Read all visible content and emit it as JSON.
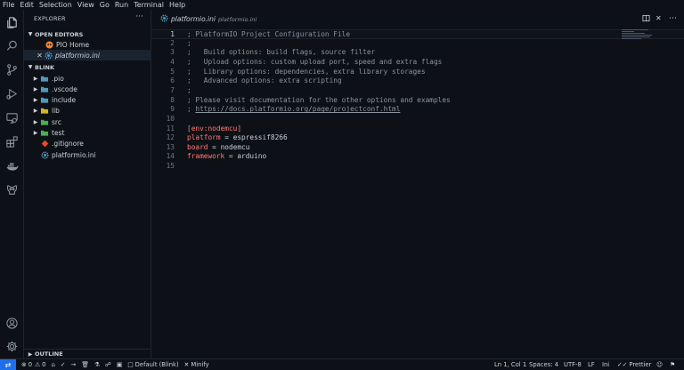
{
  "menu": [
    "File",
    "Edit",
    "Selection",
    "View",
    "Go",
    "Run",
    "Terminal",
    "Help"
  ],
  "activity_bar": {
    "top": [
      "files-icon",
      "search-icon",
      "source-control-icon",
      "run-debug-icon",
      "remote-explorer-icon",
      "extensions-icon",
      "docker-icon",
      "platformio-icon"
    ],
    "bottom": [
      "account-icon",
      "settings-gear-icon"
    ]
  },
  "sidebar": {
    "title": "EXPLORER",
    "more": "···",
    "open_editors": {
      "label": "OPEN EDITORS",
      "items": [
        {
          "name": "PIO Home",
          "icon": "platformio-icon"
        },
        {
          "name": "platformio.ini",
          "icon": "gear-icon",
          "active": true
        }
      ]
    },
    "workspace": {
      "label": "BLINK",
      "items": [
        {
          "name": ".pio",
          "type": "folder",
          "color": "#519aba"
        },
        {
          "name": ".vscode",
          "type": "folder",
          "color": "#519aba"
        },
        {
          "name": "include",
          "type": "folder",
          "color": "#519aba"
        },
        {
          "name": "lib",
          "type": "folder",
          "color": "#d4b32a"
        },
        {
          "name": "src",
          "type": "folder",
          "color": "#4caf50"
        },
        {
          "name": "test",
          "type": "folder",
          "color": "#4caf50"
        },
        {
          "name": ".gitignore",
          "type": "file",
          "icon": "git-icon"
        },
        {
          "name": "platformio.ini",
          "type": "file",
          "icon": "gear-icon"
        }
      ]
    },
    "outline": "OUTLINE"
  },
  "tab": {
    "label": "platformio.ini",
    "description": "platformio.ini"
  },
  "editor": {
    "current_line": 1,
    "lines": [
      {
        "n": "1",
        "text": "; PlatformIO Project Configuration File",
        "kind": "comment"
      },
      {
        "n": "2",
        "text": ";",
        "kind": "comment"
      },
      {
        "n": "3",
        "text": ";   Build options: build flags, source filter",
        "kind": "comment"
      },
      {
        "n": "4",
        "text": ";   Upload options: custom upload port, speed and extra flags",
        "kind": "comment"
      },
      {
        "n": "5",
        "text": ";   Library options: dependencies, extra library storages",
        "kind": "comment"
      },
      {
        "n": "6",
        "text": ";   Advanced options: extra scripting",
        "kind": "comment"
      },
      {
        "n": "7",
        "text": ";",
        "kind": "comment"
      },
      {
        "n": "8",
        "text": "; Please visit documentation for the other options and examples",
        "kind": "comment"
      },
      {
        "n": "9",
        "prefix": "; ",
        "text": "https://docs.platformio.org/page/projectconf.html",
        "kind": "link"
      },
      {
        "n": "10",
        "text": "",
        "kind": "plain"
      },
      {
        "n": "11",
        "text": "[env:nodemcu]",
        "kind": "section"
      },
      {
        "n": "12",
        "key": "platform",
        "text": " = espressif8266",
        "kind": "kv"
      },
      {
        "n": "13",
        "key": "board",
        "text": " = nodemcu",
        "kind": "kv"
      },
      {
        "n": "14",
        "key": "framework",
        "text": " = arduino",
        "kind": "kv"
      },
      {
        "n": "15",
        "text": "",
        "kind": "plain"
      }
    ]
  },
  "status": {
    "errors": "0",
    "warnings": "0",
    "env": "Default (Blink)",
    "minify": "Minify",
    "cursor": "Ln 1, Col 1",
    "spaces": "Spaces: 4",
    "encoding": "UTF-8",
    "eol": "LF",
    "language": "Ini",
    "prettier": "Prettier"
  }
}
